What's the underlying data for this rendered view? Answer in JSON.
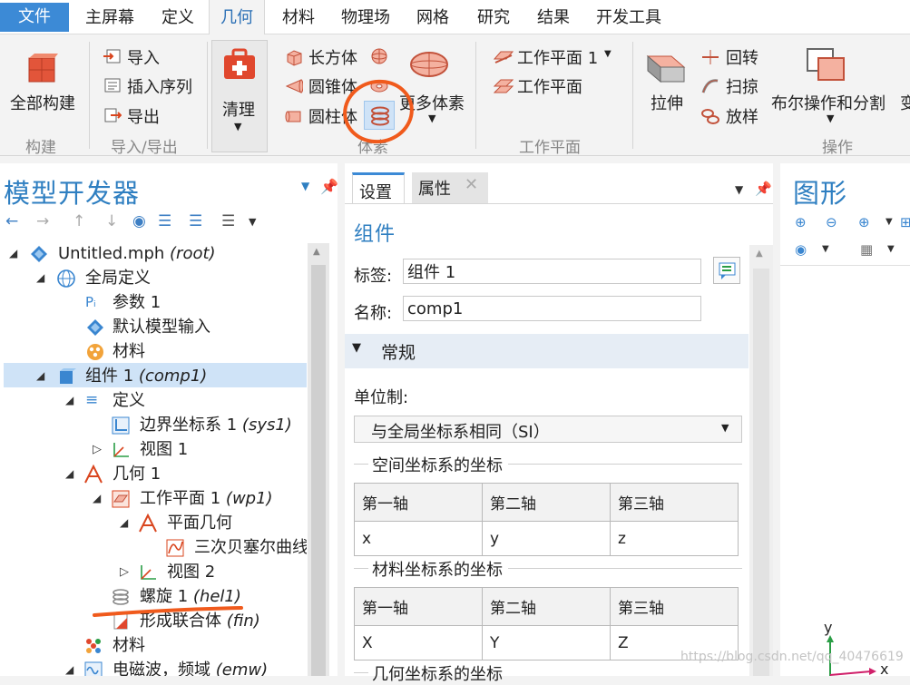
{
  "menu": {
    "file": "文件",
    "items": [
      "主屏幕",
      "定义",
      "几何",
      "材料",
      "物理场",
      "网格",
      "研究",
      "结果",
      "开发工具"
    ],
    "active": "几何"
  },
  "ribbon": {
    "build": {
      "build_all": "全部构建",
      "group": "构建"
    },
    "import_export": {
      "import": "导入",
      "insert_sequence": "插入序列",
      "export": "导出",
      "group": "导入/导出"
    },
    "clean": {
      "label": "清理"
    },
    "primitives": {
      "block": "长方体",
      "cone": "圆锥体",
      "cylinder": "圆柱体",
      "more": "更多体素",
      "group": "体素"
    },
    "work_plane": {
      "wp1": "工作平面 1",
      "wp": "工作平面",
      "group": "工作平面"
    },
    "operations": {
      "extrude": "拉伸",
      "revolve": "回转",
      "sweep": "扫掠",
      "loft": "放样",
      "boolean": "布尔操作和分割",
      "cut_label": "变",
      "group": "操作"
    }
  },
  "model_builder": {
    "title": "模型开发器",
    "tree": [
      {
        "text": "Untitled.mph",
        "tag": "(root)"
      },
      {
        "text": "全局定义",
        "tag": ""
      },
      {
        "text": "参数 1",
        "tag": ""
      },
      {
        "text": "默认模型输入",
        "tag": ""
      },
      {
        "text": "材料",
        "tag": ""
      },
      {
        "text": "组件 1",
        "tag": "(comp1)"
      },
      {
        "text": "定义",
        "tag": ""
      },
      {
        "text": "边界坐标系 1",
        "tag": "(sys1)"
      },
      {
        "text": "视图 1",
        "tag": ""
      },
      {
        "text": "几何 1",
        "tag": ""
      },
      {
        "text": "工作平面 1",
        "tag": "(wp1)"
      },
      {
        "text": "平面几何",
        "tag": ""
      },
      {
        "text": "三次贝塞尔曲线",
        "tag": ""
      },
      {
        "text": "视图 2",
        "tag": ""
      },
      {
        "text": "螺旋 1",
        "tag": "(hel1)"
      },
      {
        "text": "形成联合体",
        "tag": "(fin)"
      },
      {
        "text": "材料",
        "tag": ""
      },
      {
        "text": "电磁波，频域",
        "tag": "(emw)"
      }
    ]
  },
  "settings": {
    "tabs": [
      "设置",
      "属性"
    ],
    "heading": "组件",
    "label_caption": "标签:",
    "label_value": "组件 1",
    "name_caption": "名称:",
    "name_value": "comp1",
    "section_general": "常规",
    "unit_caption": "单位制:",
    "unit_value": "与全局坐标系相同（SI）",
    "spatial_caption": "空间坐标系的坐标",
    "material_caption": "材料坐标系的坐标",
    "geometry_caption": "几何坐标系的坐标",
    "col_headers": [
      "第一轴",
      "第二轴",
      "第三轴"
    ],
    "spatial_values": [
      "x",
      "y",
      "z"
    ],
    "material_values": [
      "X",
      "Y",
      "Z"
    ]
  },
  "graphics": {
    "title": "图形",
    "axis_y": "y",
    "axis_x": "x",
    "watermark": "https://blog.csdn.net/qq_40476619"
  }
}
